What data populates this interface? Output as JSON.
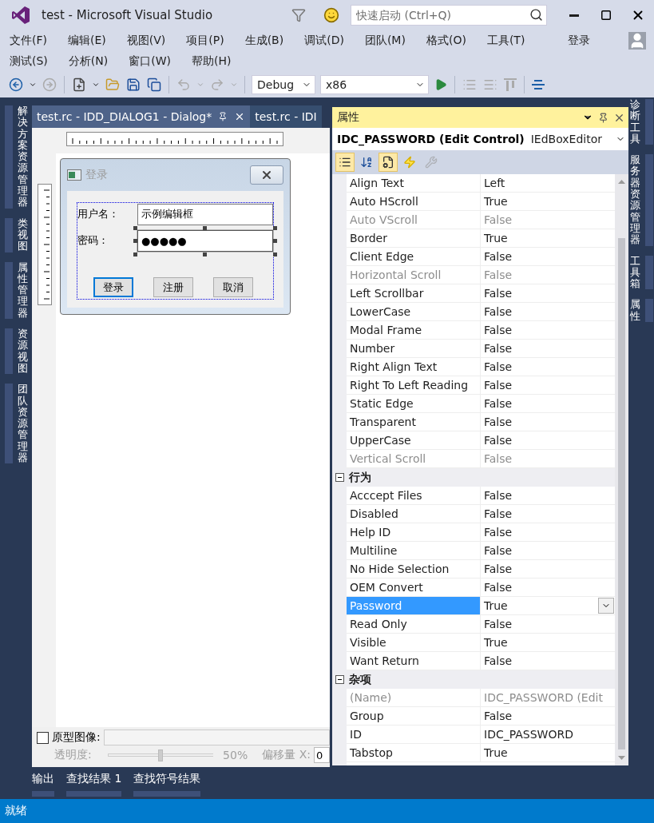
{
  "window": {
    "title": "test - Microsoft Visual Studio"
  },
  "quick_launch": {
    "placeholder": "快速启动 (Ctrl+Q)"
  },
  "menu": {
    "rows": [
      [
        "文件(F)",
        "编辑(E)",
        "视图(V)",
        "项目(P)",
        "生成(B)",
        "调试(D)",
        "团队(M)",
        "格式(O)",
        "工具(T)"
      ],
      [
        "测试(S)",
        "分析(N)",
        "窗口(W)",
        "帮助(H)"
      ]
    ],
    "sign_in": "登录"
  },
  "toolbar": {
    "configuration": "Debug",
    "platform": "x86"
  },
  "left_tabs": [
    "解决方案资源管理器",
    "类视图",
    "属性管理器",
    "资源视图",
    "团队资源管理器"
  ],
  "document_tabs": [
    {
      "label": "test.rc - IDD_DIALOG1 - Dialog*",
      "selected": true
    },
    {
      "label": "test.rc - IDI",
      "selected": false
    }
  ],
  "dialog": {
    "title": "登录",
    "fields": [
      {
        "label": "用户名：",
        "value": "示例编辑框",
        "selected": false
      },
      {
        "label": "密码：",
        "value": "●●●●●",
        "selected": true
      }
    ],
    "buttons": [
      {
        "label": "登录",
        "focused": true
      },
      {
        "label": "注册",
        "focused": false
      },
      {
        "label": "取消",
        "focused": false
      }
    ]
  },
  "prototype": {
    "label": "原型图像:",
    "checked": false,
    "opacity_label": "透明度:",
    "level": 0.5,
    "opacity_reading": "50%",
    "offset_label": "偏移量 X:",
    "offset_value": "0"
  },
  "properties": {
    "title": "属性",
    "object": "IDC_PASSWORD (Edit Control)",
    "object_type": "IEdBoxEditor",
    "tools": [
      {
        "kind": "categorized",
        "selected": true,
        "disabled": false
      },
      {
        "kind": "alphabetical",
        "selected": false,
        "disabled": false
      },
      {
        "kind": "properties",
        "selected": true,
        "disabled": false
      },
      {
        "kind": "events",
        "selected": false,
        "disabled": false
      },
      {
        "kind": "pages",
        "selected": false,
        "disabled": true
      }
    ],
    "groups": [
      {
        "rows": [
          {
            "name": "Align Text",
            "value": "Left",
            "disabled": false,
            "selected": false
          },
          {
            "name": "Auto HScroll",
            "value": "True",
            "disabled": false,
            "selected": false
          },
          {
            "name": "Auto VScroll",
            "value": "False",
            "disabled": true,
            "selected": false
          },
          {
            "name": "Border",
            "value": "True",
            "disabled": false,
            "selected": false
          },
          {
            "name": "Client Edge",
            "value": "False",
            "disabled": false,
            "selected": false
          },
          {
            "name": "Horizontal Scroll",
            "value": "False",
            "disabled": true,
            "selected": false
          },
          {
            "name": "Left Scrollbar",
            "value": "False",
            "disabled": false,
            "selected": false
          },
          {
            "name": "LowerCase",
            "value": "False",
            "disabled": false,
            "selected": false
          },
          {
            "name": "Modal Frame",
            "value": "False",
            "disabled": false,
            "selected": false
          },
          {
            "name": "Number",
            "value": "False",
            "disabled": false,
            "selected": false
          },
          {
            "name": "Right Align Text",
            "value": "False",
            "disabled": false,
            "selected": false
          },
          {
            "name": "Right To Left Reading",
            "value": "False",
            "disabled": false,
            "selected": false
          },
          {
            "name": "Static Edge",
            "value": "False",
            "disabled": false,
            "selected": false
          },
          {
            "name": "Transparent",
            "value": "False",
            "disabled": false,
            "selected": false
          },
          {
            "name": "UpperCase",
            "value": "False",
            "disabled": false,
            "selected": false
          },
          {
            "name": "Vertical Scroll",
            "value": "False",
            "disabled": true,
            "selected": false
          }
        ]
      },
      {
        "title": "行为",
        "expanded": true,
        "rows": [
          {
            "name": "Acccept Files",
            "value": "False",
            "disabled": false,
            "selected": false
          },
          {
            "name": "Disabled",
            "value": "False",
            "disabled": false,
            "selected": false
          },
          {
            "name": "Help ID",
            "value": "False",
            "disabled": false,
            "selected": false
          },
          {
            "name": "Multiline",
            "value": "False",
            "disabled": false,
            "selected": false
          },
          {
            "name": "No Hide Selection",
            "value": "False",
            "disabled": false,
            "selected": false
          },
          {
            "name": "OEM Convert",
            "value": "False",
            "disabled": false,
            "selected": false
          },
          {
            "name": "Password",
            "value": "True",
            "disabled": false,
            "selected": true
          },
          {
            "name": "Read Only",
            "value": "False",
            "disabled": false,
            "selected": false
          },
          {
            "name": "Visible",
            "value": "True",
            "disabled": false,
            "selected": false
          },
          {
            "name": "Want Return",
            "value": "False",
            "disabled": false,
            "selected": false
          }
        ]
      },
      {
        "title": "杂项",
        "expanded": true,
        "rows": [
          {
            "name": "(Name)",
            "value": "IDC_PASSWORD (Edit",
            "disabled": true,
            "selected": false
          },
          {
            "name": "Group",
            "value": "False",
            "disabled": false,
            "selected": false
          },
          {
            "name": "ID",
            "value": "IDC_PASSWORD",
            "disabled": false,
            "selected": false
          },
          {
            "name": "Tabstop",
            "value": "True",
            "disabled": false,
            "selected": false
          }
        ]
      }
    ]
  },
  "right_tabs": [
    "诊断工具",
    "服务器资源管理器",
    "工具箱",
    "属性"
  ],
  "bottom_tabs": [
    "输出",
    "查找结果 1",
    "查找符号结果"
  ],
  "status_bar": {
    "text": "就绪"
  }
}
